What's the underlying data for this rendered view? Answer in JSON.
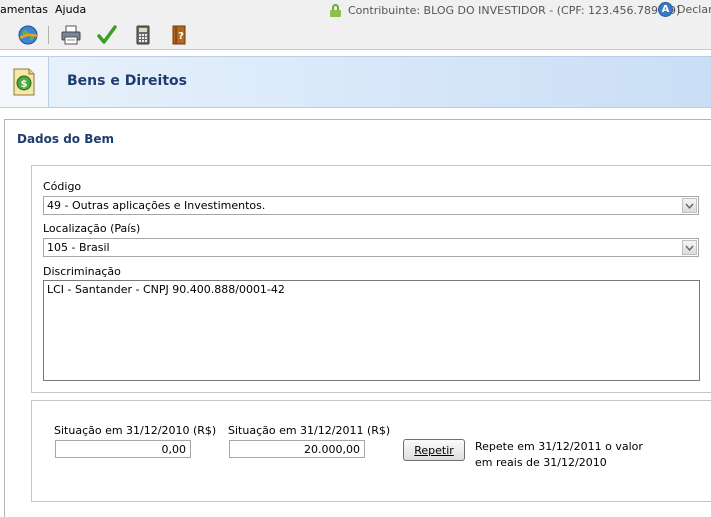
{
  "menubar": {
    "items": [
      "amentas",
      "Ajuda"
    ],
    "contributor": "Contribuinte: BLOG DO INVESTIDOR - (CPF: 123.456.789-09)",
    "declaration": "Declara",
    "declaration_badge": "A"
  },
  "toolbar": {
    "icons": [
      "globe-icon",
      "print-icon",
      "check-icon",
      "calculator-icon",
      "help-book-icon"
    ]
  },
  "header": {
    "title": "Bens e Direitos",
    "icon": "money-document-icon"
  },
  "form": {
    "section_title": "Dados do Bem",
    "codigo_label": "Código",
    "codigo_value": "49 - Outras aplicações e Investimentos.",
    "localizacao_label": "Localização (País)",
    "localizacao_value": "105 - Brasil",
    "discriminacao_label": "Discriminação",
    "discriminacao_value": "LCI - Santander - CNPJ 90.400.888/0001-42",
    "situacao_2010_label": "Situação em 31/12/2010 (R$)",
    "situacao_2010_value": "0,00",
    "situacao_2011_label": "Situação em 31/12/2011 (R$)",
    "situacao_2011_value": "20.000,00",
    "repetir_label": "Repetir",
    "repetir_note_line1": "Repete em 31/12/2011 o valor",
    "repetir_note_line2": "em reais de 31/12/2010"
  },
  "colors": {
    "title_blue": "#1e3d6e",
    "header_gradient_start": "#e9f2fb",
    "header_gradient_end": "#c9def5",
    "check_green": "#3aa021"
  }
}
